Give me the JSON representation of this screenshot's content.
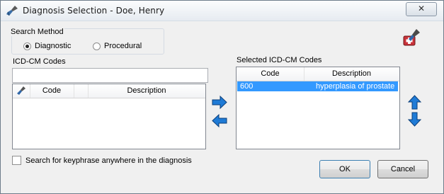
{
  "window": {
    "title": "Diagnosis Selection - Doe, Henry"
  },
  "search_method": {
    "label": "Search Method",
    "options": [
      {
        "label": "Diagnostic",
        "selected": true
      },
      {
        "label": "Procedural",
        "selected": false
      }
    ]
  },
  "icd_list": {
    "label": "ICD-CM Codes",
    "search_value": "",
    "columns": [
      "Code",
      "Description"
    ],
    "rows": []
  },
  "selected_list": {
    "label": "Selected ICD-CM Codes",
    "columns": [
      "Code",
      "Description"
    ],
    "rows": [
      {
        "code": "600",
        "description": "hyperplasia of prostate"
      }
    ]
  },
  "options": {
    "anywhere_label": "Search for keyphrase anywhere in the diagnosis",
    "anywhere_checked": false
  },
  "buttons": {
    "ok": "OK",
    "cancel": "Cancel"
  },
  "icons": [
    "broom-icon",
    "medical-kit-icon",
    "arrow-right-icon",
    "arrow-left-icon",
    "arrow-up-icon",
    "arrow-down-icon",
    "close-icon"
  ],
  "colors": {
    "selection": "#3399ff",
    "arrow_blue": "#1f7bd6"
  }
}
